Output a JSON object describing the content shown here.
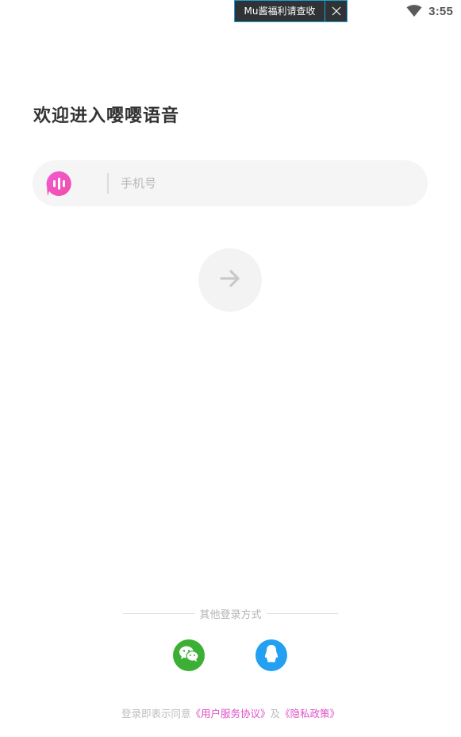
{
  "status_bar": {
    "time": "3:55",
    "wifi_icon": "wifi-icon"
  },
  "promo_toast": {
    "label": "Mu酱福利请查收",
    "close_icon": "close-icon"
  },
  "welcome": {
    "title": "欢迎进入嘤嘤语音"
  },
  "phone_form": {
    "logo_icon": "app-logo-icon",
    "placeholder": "手机号",
    "value": ""
  },
  "next_button": {
    "icon": "arrow-right-icon"
  },
  "other_login": {
    "label": "其他登录方式",
    "providers": [
      {
        "name": "wechat",
        "icon": "wechat-icon",
        "color": "#3cb034"
      },
      {
        "name": "qq",
        "icon": "qq-icon",
        "color": "#23a0f2"
      }
    ]
  },
  "agreement": {
    "prefix": "登录即表示同意",
    "user_agreement": "《用户服务协议》",
    "conjunction": "及",
    "privacy_policy": "《隐私政策》"
  },
  "colors": {
    "accent_pink": "#e04fc8",
    "logo_gradient_start": "#f25ad6",
    "logo_gradient_end": "#f04ea6",
    "toast_border": "#1ea0d6"
  }
}
